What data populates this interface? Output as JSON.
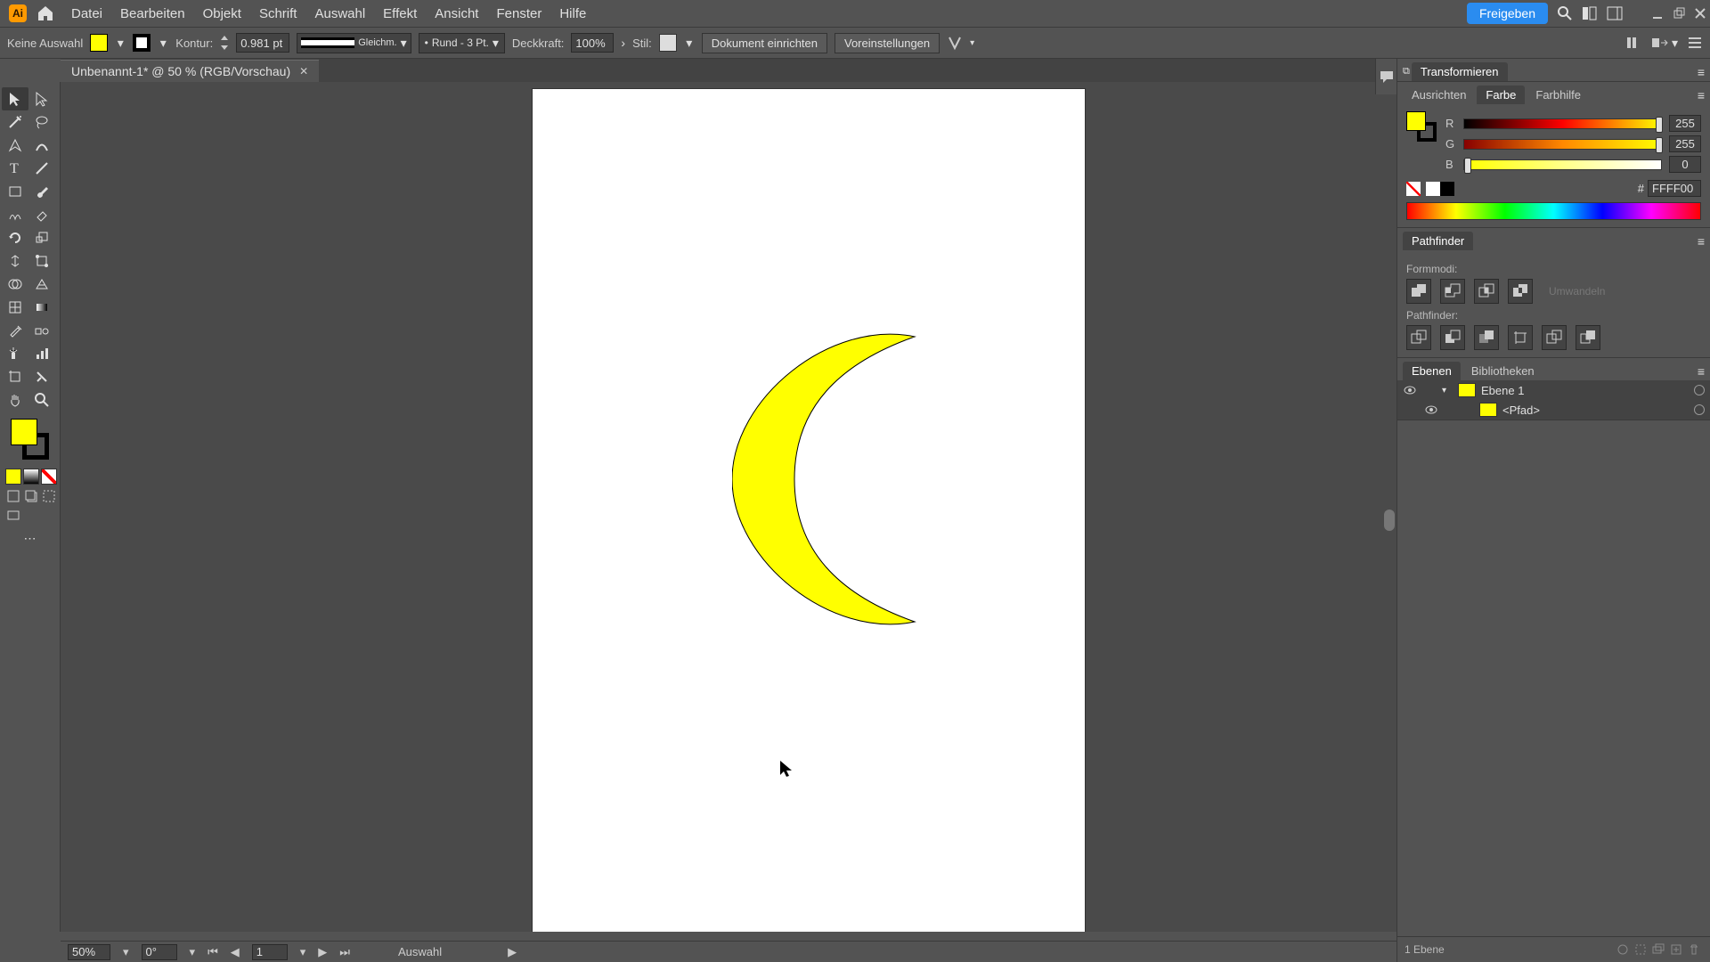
{
  "menubar": {
    "items": [
      "Datei",
      "Bearbeiten",
      "Objekt",
      "Schrift",
      "Auswahl",
      "Effekt",
      "Ansicht",
      "Fenster",
      "Hilfe"
    ],
    "share": "Freigeben"
  },
  "optbar": {
    "status": "Keine Auswahl",
    "kontur_label": "Kontur:",
    "kontur_value": "0.981 pt",
    "stroke_profile": "Gleichm.",
    "brush_value": "Rund - 3 Pt.",
    "deck_label": "Deckkraft:",
    "deck_value": "100%",
    "stil_label": "Stil:",
    "btn_doc": "Dokument einrichten",
    "btn_pref": "Voreinstellungen"
  },
  "doc": {
    "title": "Unbenannt-1* @ 50 % (RGB/Vorschau)"
  },
  "status": {
    "zoom": "50%",
    "rotate": "0°",
    "artboard": "1",
    "tool": "Auswahl"
  },
  "panels": {
    "transform": "Transformieren",
    "align": "Ausrichten",
    "farbe": "Farbe",
    "farbhilfe": "Farbhilfe",
    "r": "R",
    "r_val": "255",
    "g": "G",
    "g_val": "255",
    "b": "B",
    "b_val": "0",
    "hex_hash": "#",
    "hex_val": "FFFF00",
    "pathfinder": "Pathfinder",
    "formmodi": "Formmodi:",
    "pathfinder_lbl": "Pathfinder:",
    "umwandeln": "Umwandeln",
    "ebenen": "Ebenen",
    "biblio": "Bibliotheken",
    "layer1": "Ebene 1",
    "path": "<Pfad>",
    "layer_count": "1 Ebene"
  },
  "chart_data": null
}
